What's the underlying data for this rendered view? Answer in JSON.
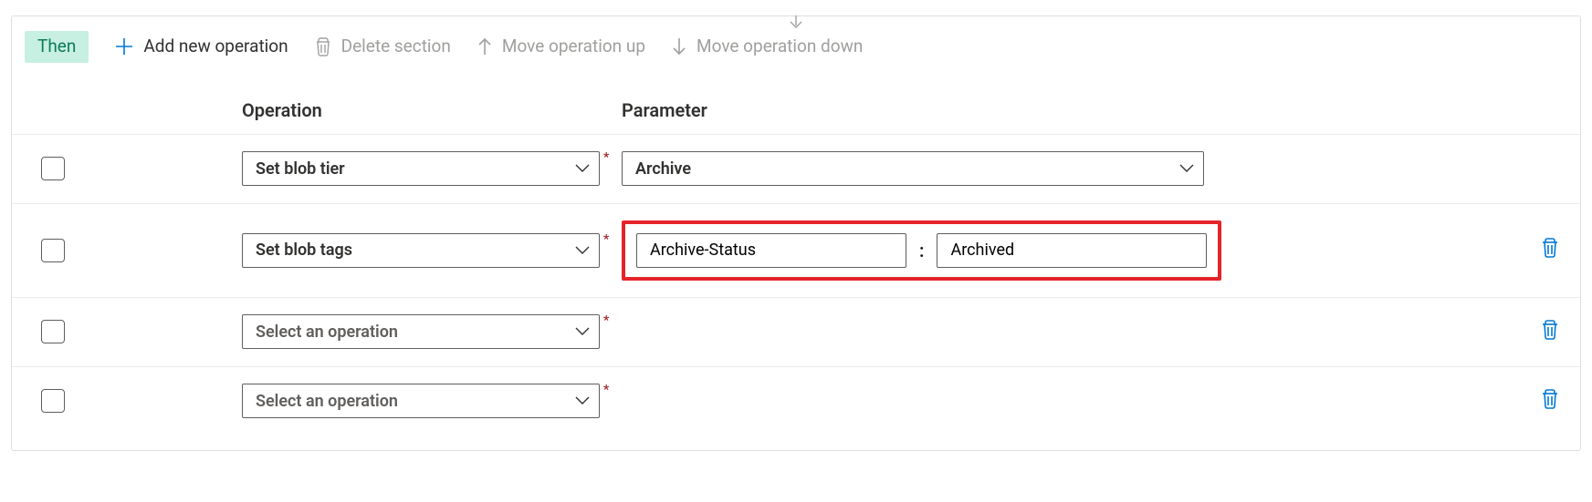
{
  "toolbar": {
    "badge": "Then",
    "add_label": "Add new operation",
    "delete_label": "Delete section",
    "move_up_label": "Move operation up",
    "move_down_label": "Move operation down"
  },
  "headers": {
    "operation": "Operation",
    "parameter": "Parameter"
  },
  "rows": [
    {
      "operation": "Set blob tier",
      "parameter_select": "Archive",
      "placeholder": false
    },
    {
      "operation": "Set blob tags",
      "tag_key": "Archive-Status",
      "tag_value": "Archived",
      "placeholder": false
    },
    {
      "operation": "Select an operation",
      "placeholder": true
    },
    {
      "operation": "Select an operation",
      "placeholder": true
    }
  ],
  "required_marker": "*",
  "tag_separator": ":"
}
